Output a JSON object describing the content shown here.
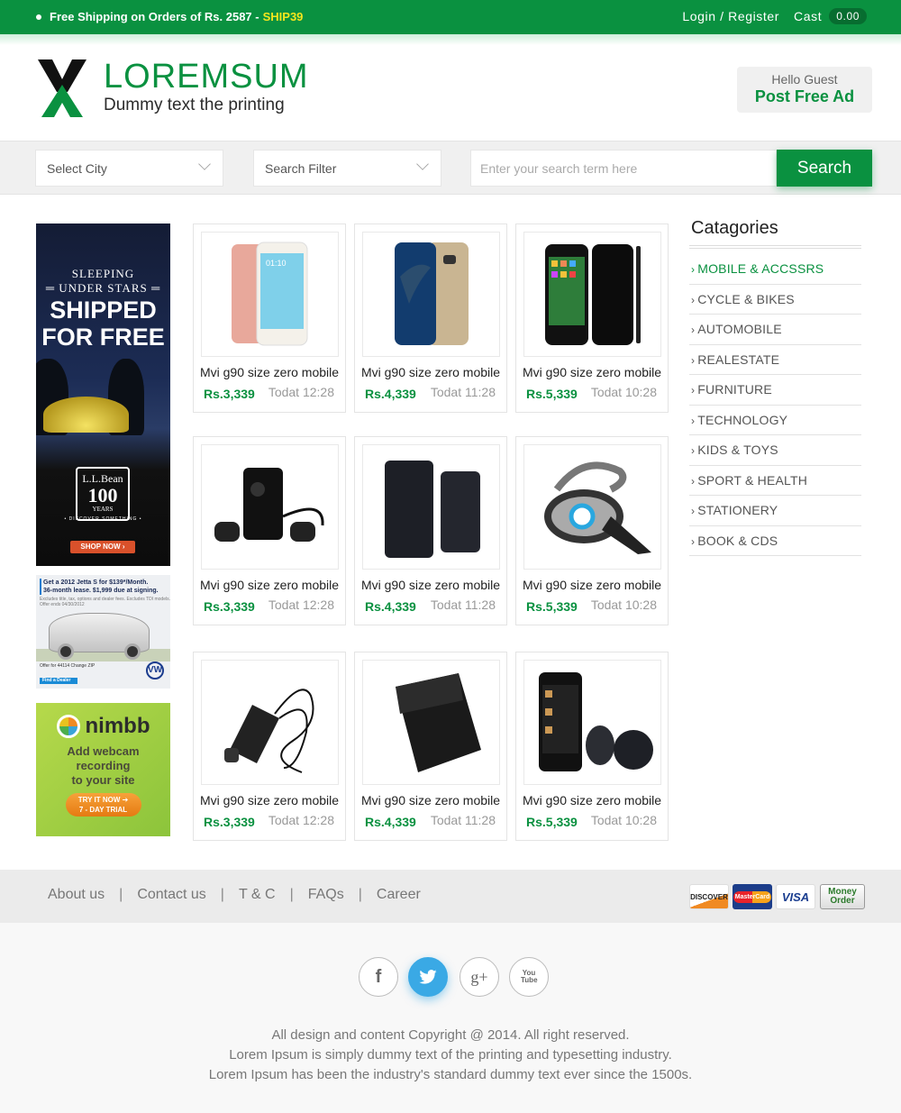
{
  "topbar": {
    "promo_text": "Free Shipping on Orders of Rs. 2587 -",
    "promo_code": "SHIP39",
    "login_label": "Login / Register",
    "cast_label": "Cast",
    "cast_value": "0.00"
  },
  "header": {
    "brand_name": "LOREMSUM",
    "tagline": "Dummy text the printing",
    "greeting": "Hello Guest",
    "post_ad_label": "Post Free Ad"
  },
  "search": {
    "city_select": "Select City",
    "filter_select": "Search Filter",
    "placeholder": "Enter your search term here",
    "button_label": "Search"
  },
  "ads": {
    "llbean": {
      "line1": "SLEEPING",
      "line2": "═ UNDER STARS ═",
      "line3": "SHIPPED",
      "line4": "FOR FREE",
      "brand": "L.L.Bean",
      "years_num": "100",
      "years_label": "YEARS",
      "slogan": "• DISCOVER SOMETHING •",
      "cta": "SHOP NOW ›"
    },
    "vw": {
      "headline1": "Get a 2012 Jetta S for $139*/Month.",
      "headline2": "36-month lease. $1,999 due at signing.",
      "fine_print": "Excludes title, tax, options and dealer fees. Excludes TDI models. Offer ends 04/30/2012",
      "offer": "Offer for 44114  Change ZIP",
      "cta": "Find a Dealer",
      "logo": "VW"
    },
    "nimbb": {
      "brand": "nimbb",
      "copy1": "Add webcam",
      "copy2": "recording",
      "copy3": "to your site",
      "cta1": "TRY IT NOW ➔",
      "cta2": "7 - DAY TRIAL"
    }
  },
  "products": [
    {
      "title": "Mvi g90 size zero mobile",
      "price": "Rs.3,339",
      "time": "Todat 12:28",
      "image": "rose-gold-smartphone"
    },
    {
      "title": "Mvi g90 size zero mobile",
      "price": "Rs.4,339",
      "time": "Todat 11:28",
      "image": "gold-galaxy-phone"
    },
    {
      "title": "Mvi g90 size zero mobile",
      "price": "Rs.5,339",
      "time": "Todat 10:28",
      "image": "black-iphone"
    },
    {
      "title": "Mvi g90 size zero mobile",
      "price": "Rs.3,339",
      "time": "Todat 12:28",
      "image": "bluetooth-earphones"
    },
    {
      "title": "Mvi g90 size zero mobile",
      "price": "Rs.4,339",
      "time": "Todat 11:28",
      "image": "power-banks"
    },
    {
      "title": "Mvi g90 size zero mobile",
      "price": "Rs.5,339",
      "time": "Todat 10:28",
      "image": "bluetooth-headset"
    },
    {
      "title": "Mvi g90 size zero mobile",
      "price": "Rs.3,339",
      "time": "Todat 12:28",
      "image": "car-charger"
    },
    {
      "title": "Mvi g90 size zero mobile",
      "price": "Rs.4,339",
      "time": "Todat 11:28",
      "image": "leather-phone-case"
    },
    {
      "title": "Mvi g90 size zero mobile",
      "price": "Rs.5,339",
      "time": "Todat 10:28",
      "image": "phone-with-trackers"
    }
  ],
  "categories": {
    "title": "Catagories",
    "items": [
      {
        "label": "MOBILE & ACCSSRS",
        "active": true
      },
      {
        "label": "CYCLE & BIKES"
      },
      {
        "label": "AUTOMOBILE"
      },
      {
        "label": "REALESTATE"
      },
      {
        "label": "FURNITURE"
      },
      {
        "label": "TECHNOLOGY"
      },
      {
        "label": "KIDS & TOYS"
      },
      {
        "label": "SPORT & HEALTH"
      },
      {
        "label": "STATIONERY"
      },
      {
        "label": "BOOK & CDS"
      }
    ]
  },
  "footer": {
    "links": [
      "About us",
      "Contact us",
      "T & C",
      "FAQs",
      "Career"
    ],
    "separator": "|",
    "payments": [
      "DISCOVER",
      "MasterCard",
      "VISA",
      "Money Order"
    ],
    "social": [
      {
        "name": "facebook",
        "glyph": "f"
      },
      {
        "name": "twitter",
        "glyph": "🐦"
      },
      {
        "name": "google-plus",
        "glyph": "g+"
      },
      {
        "name": "youtube",
        "glyph": "You Tube"
      }
    ],
    "copyright": [
      "All design and content Copyright @ 2014. All right reserved.",
      "Lorem Ipsum is simply dummy text of the printing and typesetting industry.",
      "Lorem Ipsum has been the industry's standard dummy text ever since the 1500s."
    ]
  },
  "colors": {
    "brand_green": "#0a9140",
    "promo_yellow": "#f5e61d",
    "twitter_blue": "#3aa9e5"
  }
}
